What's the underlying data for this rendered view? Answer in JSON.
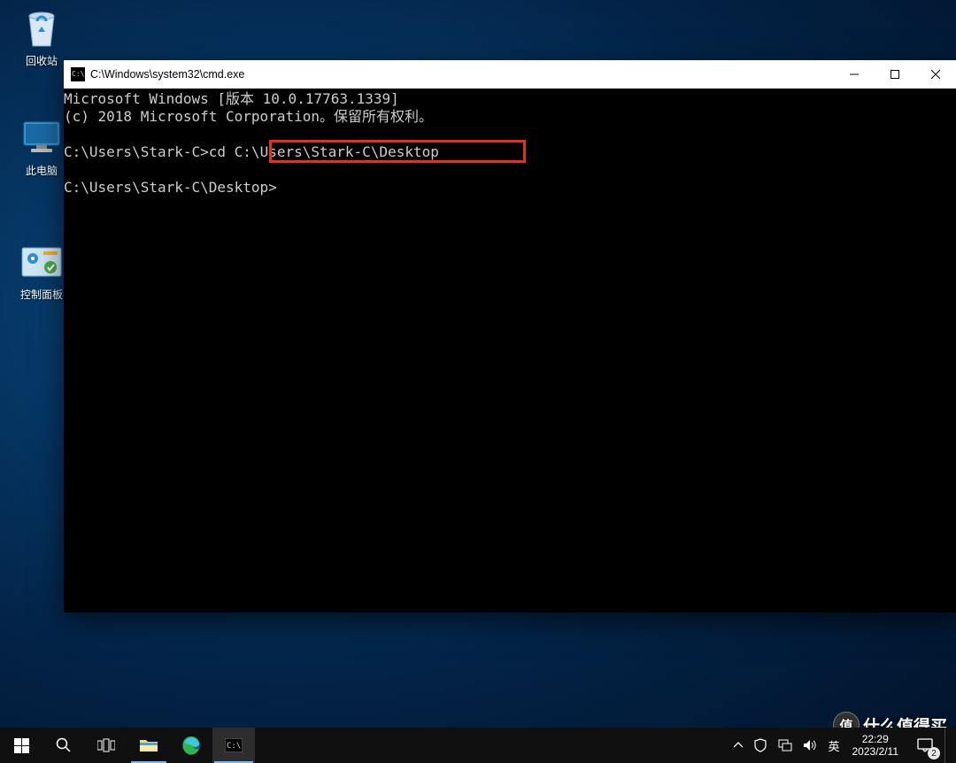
{
  "desktop": {
    "icons": [
      {
        "name": "recycle-bin",
        "label": "回收站"
      },
      {
        "name": "this-pc",
        "label": "此电脑"
      },
      {
        "name": "control-panel",
        "label": "控制面板"
      }
    ]
  },
  "cmd": {
    "title": "C:\\Windows\\system32\\cmd.exe",
    "lines": {
      "l1": "Microsoft Windows [版本 10.0.17763.1339]",
      "l2": "(c) 2018 Microsoft Corporation。保留所有权利。",
      "l3": "",
      "l4_prompt": "C:\\Users\\Stark-C>",
      "l4_cmd": "cd C:\\Users\\Stark-C\\Desktop",
      "l5": "",
      "l6": "C:\\Users\\Stark-C\\Desktop>"
    }
  },
  "taskbar": {
    "tray": {
      "ime_label": "英",
      "time": "22:29",
      "date": "2023/2/11",
      "notif_count": "2"
    }
  },
  "watermark": {
    "badge": "值",
    "text": "什么值得买"
  }
}
